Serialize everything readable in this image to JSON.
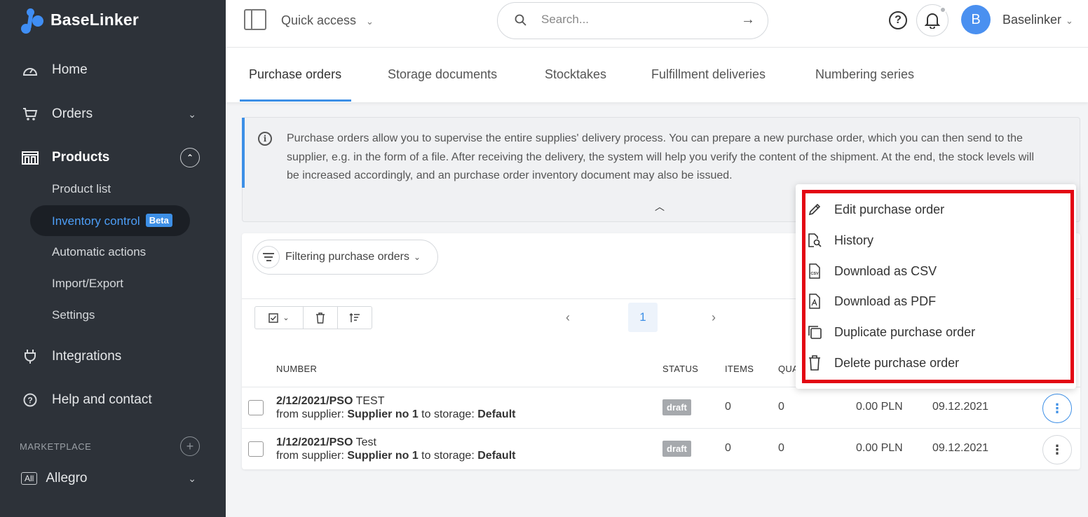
{
  "brand": {
    "name": "BaseLinker"
  },
  "sidebar": {
    "items": [
      {
        "label": "Home"
      },
      {
        "label": "Orders"
      },
      {
        "label": "Products"
      },
      {
        "label": "Integrations"
      },
      {
        "label": "Help and contact"
      }
    ],
    "products_sub": [
      {
        "label": "Product list"
      },
      {
        "label": "Inventory control",
        "badge": "Beta"
      },
      {
        "label": "Automatic actions"
      },
      {
        "label": "Import/Export"
      },
      {
        "label": "Settings"
      }
    ],
    "marketplace_heading": "MARKETPLACE",
    "marketplace_item": {
      "badge": "All",
      "label": "Allegro"
    }
  },
  "header": {
    "quick_access": "Quick access",
    "search_placeholder": "Search...",
    "avatar_letter": "B",
    "username": "Baselinker"
  },
  "tabs": [
    {
      "label": "Purchase orders",
      "active": true
    },
    {
      "label": "Storage documents"
    },
    {
      "label": "Stocktakes"
    },
    {
      "label": "Fulfillment deliveries"
    },
    {
      "label": "Numbering series"
    }
  ],
  "info": {
    "text": "Purchase orders allow you to supervise the entire supplies' delivery process. You can prepare a new purchase order, which you can then send to the supplier, e.g. in the form of a file. After receiving the delivery, the system will help you verify the content of the shipment. At the end, the stock levels will be increased accordingly, and an purchase order inventory document may also be issued."
  },
  "filter": {
    "label": "Filtering purchase orders"
  },
  "pagination": {
    "current": "1"
  },
  "table": {
    "headers": {
      "number": "NUMBER",
      "status": "STATUS",
      "items": "ITEMS",
      "qty": "QUA"
    },
    "from_label": "from supplier:",
    "to_label": "to storage:",
    "rows": [
      {
        "number": "2/12/2021/PSO",
        "name": "TEST",
        "supplier": "Supplier no 1",
        "storage": "Default",
        "status": "draft",
        "items": "0",
        "qty": "0",
        "value": "0.00 PLN",
        "date": "09.12.2021"
      },
      {
        "number": "1/12/2021/PSO",
        "name": "Test",
        "supplier": "Supplier no 1",
        "storage": "Default",
        "status": "draft",
        "items": "0",
        "qty": "0",
        "value": "0.00 PLN",
        "date": "09.12.2021"
      }
    ]
  },
  "menu": {
    "items": [
      {
        "label": "Edit purchase order",
        "icon": "pencil-icon"
      },
      {
        "label": "History",
        "icon": "file-search-icon"
      },
      {
        "label": "Download as CSV",
        "icon": "csv-file-icon"
      },
      {
        "label": "Download as PDF",
        "icon": "pdf-file-icon"
      },
      {
        "label": "Duplicate purchase order",
        "icon": "copy-icon"
      },
      {
        "label": "Delete purchase order",
        "icon": "trash-icon"
      }
    ],
    "highlight_color": "#e30613"
  },
  "colors": {
    "sidebar_bg": "#2d3239",
    "accent": "#3d8fe6"
  }
}
